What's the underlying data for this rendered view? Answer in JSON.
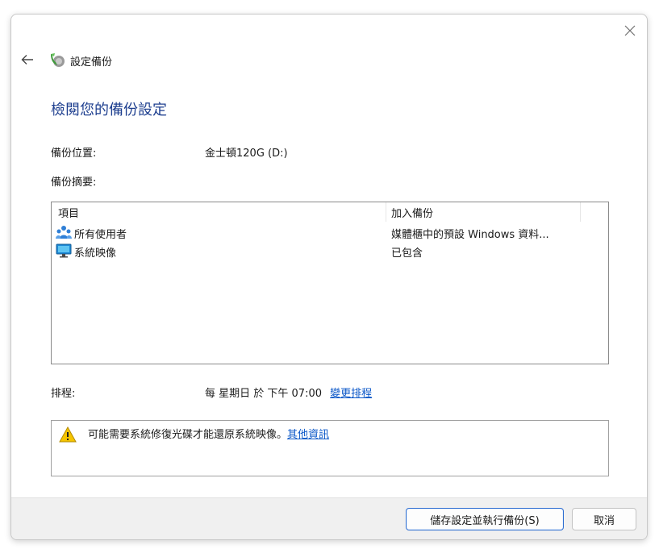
{
  "window": {
    "title": "設定備份",
    "close_icon": "close-icon",
    "back_icon": "back-arrow-icon",
    "app_icon": "backup-app-icon"
  },
  "heading": "檢閱您的備份設定",
  "backup_location": {
    "label": "備份位置:",
    "value": "金士頓120G (D:)"
  },
  "backup_summary": {
    "label": "備份摘要:",
    "columns": [
      "項目",
      "加入備份"
    ],
    "rows": [
      {
        "icon": "users-icon",
        "name": "所有使用者",
        "value": "媒體櫃中的預設 Windows 資料..."
      },
      {
        "icon": "monitor-icon",
        "name": "系統映像",
        "value": "已包含"
      }
    ]
  },
  "schedule": {
    "label": "排程:",
    "value": "每 星期日 於 下午 07:00",
    "change_link": "變更排程"
  },
  "notice": {
    "icon": "warning-icon",
    "text": "可能需要系統修復光碟才能還原系統映像。",
    "link": "其他資訊"
  },
  "buttons": {
    "save_run": "儲存設定並執行備份(S)",
    "cancel": "取消"
  },
  "colors": {
    "heading": "#1e3f8f",
    "link": "#0b57c8",
    "primary_border": "#2f6fd1"
  }
}
